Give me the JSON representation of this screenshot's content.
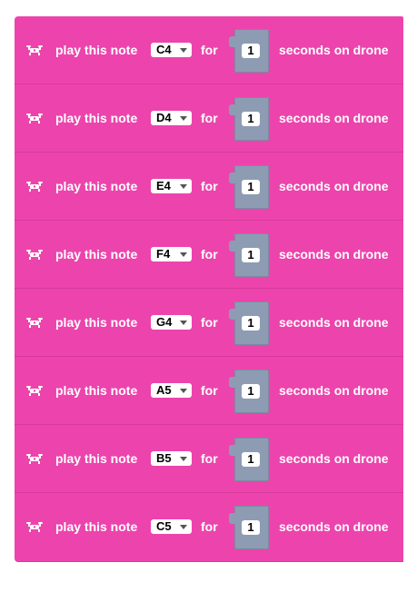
{
  "colors": {
    "block": "#ec44ac",
    "value_slot": "#8d9cb2"
  },
  "icons": {
    "block_icon": "drone-icon"
  },
  "blocks": [
    {
      "play_label": "play this note",
      "note": "C4",
      "for_label": "for",
      "duration": "1",
      "suffix": "seconds on drone"
    },
    {
      "play_label": "play this note",
      "note": "D4",
      "for_label": "for",
      "duration": "1",
      "suffix": "seconds on drone"
    },
    {
      "play_label": "play this note",
      "note": "E4",
      "for_label": "for",
      "duration": "1",
      "suffix": "seconds on drone"
    },
    {
      "play_label": "play this note",
      "note": "F4",
      "for_label": "for",
      "duration": "1",
      "suffix": "seconds on drone"
    },
    {
      "play_label": "play this note",
      "note": "G4",
      "for_label": "for",
      "duration": "1",
      "suffix": "seconds on drone"
    },
    {
      "play_label": "play this note",
      "note": "A5",
      "for_label": "for",
      "duration": "1",
      "suffix": "seconds on drone"
    },
    {
      "play_label": "play this note",
      "note": "B5",
      "for_label": "for",
      "duration": "1",
      "suffix": "seconds on drone"
    },
    {
      "play_label": "play this note",
      "note": "C5",
      "for_label": "for",
      "duration": "1",
      "suffix": "seconds on drone"
    }
  ]
}
